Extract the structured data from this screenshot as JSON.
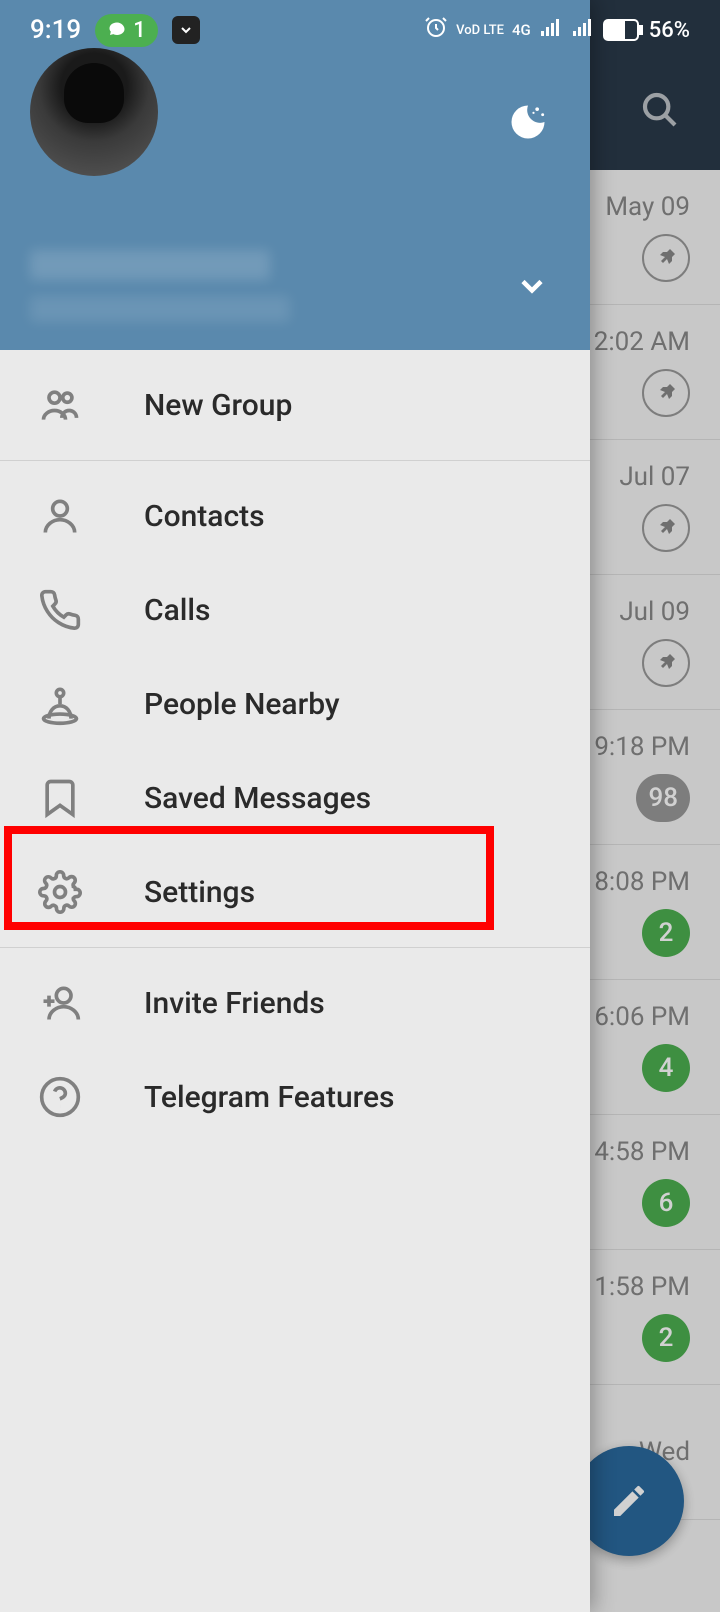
{
  "status_bar": {
    "time": "9:19",
    "call_count": "1",
    "battery": "56%",
    "network1": "VoD LTE",
    "network2": "4G"
  },
  "drawer": {
    "items": {
      "new_group": "New Group",
      "contacts": "Contacts",
      "calls": "Calls",
      "people_nearby": "People Nearby",
      "saved_messages": "Saved Messages",
      "settings": "Settings",
      "invite_friends": "Invite Friends",
      "telegram_features": "Telegram Features"
    }
  },
  "background_chats": [
    {
      "time": "May 09",
      "pinned": true
    },
    {
      "time": "2:02 AM",
      "pinned": true
    },
    {
      "time": "Jul 07",
      "pinned": true,
      "check": true
    },
    {
      "time": "Jul 09",
      "pinned": true
    },
    {
      "time": "9:18 PM",
      "count": "98",
      "grey": true
    },
    {
      "time": "8:08 PM",
      "count": "2"
    },
    {
      "time": "6:06 PM",
      "count": "4"
    },
    {
      "time": "4:58 PM",
      "count": "6"
    },
    {
      "time": "1:58 PM",
      "count": "2"
    },
    {
      "time": "Wed"
    }
  ]
}
